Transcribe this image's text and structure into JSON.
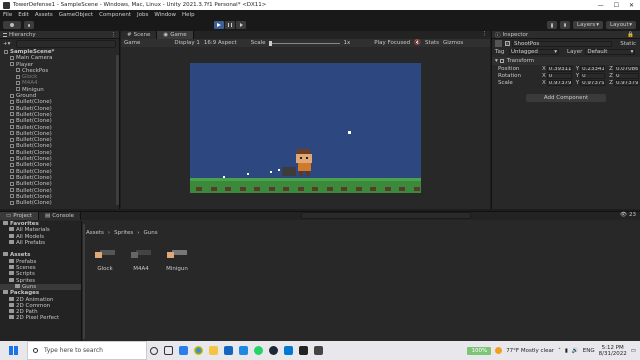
{
  "window": {
    "title": "TowerDefense1 - SampleScene - Windows, Mac, Linux - Unity 2021.3.7f1 Personal* <DX11>",
    "controls": [
      "—",
      "☐",
      "✕"
    ]
  },
  "menu": [
    "File",
    "Edit",
    "Assets",
    "GameObject",
    "Component",
    "Jobs",
    "Window",
    "Help"
  ],
  "toolbar": {
    "layers": "Layers",
    "layout": "Layout"
  },
  "hierarchy": {
    "tab": "Hierarchy",
    "rows": [
      {
        "label": "SampleScene*",
        "indent": 0,
        "bold": true
      },
      {
        "label": "Main Camera",
        "indent": 1
      },
      {
        "label": "Player",
        "indent": 1
      },
      {
        "label": "CheckPos",
        "indent": 2
      },
      {
        "label": "Glock",
        "indent": 2,
        "dim": true
      },
      {
        "label": "M4A4",
        "indent": 2,
        "dim": true
      },
      {
        "label": "Minigun",
        "indent": 2
      },
      {
        "label": "Ground",
        "indent": 1
      },
      {
        "label": "Bullet(Clone)",
        "indent": 1
      },
      {
        "label": "Bullet(Clone)",
        "indent": 1
      },
      {
        "label": "Bullet(Clone)",
        "indent": 1
      },
      {
        "label": "Bullet(Clone)",
        "indent": 1
      },
      {
        "label": "Bullet(Clone)",
        "indent": 1
      },
      {
        "label": "Bullet(Clone)",
        "indent": 1
      },
      {
        "label": "Bullet(Clone)",
        "indent": 1
      },
      {
        "label": "Bullet(Clone)",
        "indent": 1
      },
      {
        "label": "Bullet(Clone)",
        "indent": 1
      },
      {
        "label": "Bullet(Clone)",
        "indent": 1
      },
      {
        "label": "Bullet(Clone)",
        "indent": 1
      },
      {
        "label": "Bullet(Clone)",
        "indent": 1
      },
      {
        "label": "Bullet(Clone)",
        "indent": 1
      },
      {
        "label": "Bullet(Clone)",
        "indent": 1
      },
      {
        "label": "Bullet(Clone)",
        "indent": 1
      },
      {
        "label": "Bullet(Clone)",
        "indent": 1
      },
      {
        "label": "Bullet(Clone)",
        "indent": 1
      }
    ]
  },
  "game": {
    "tabs": [
      "Scene",
      "Game"
    ],
    "bar": {
      "mode": "Game",
      "display": "Display 1",
      "aspect": "16:9 Aspect",
      "scale_label": "Scale",
      "scale_value": "1x",
      "play_focused": "Play Focused",
      "stats": "Stats",
      "gizmos": "Gizmos"
    }
  },
  "inspector": {
    "tab": "Inspector",
    "object_name": "ShootPos",
    "static": "Static",
    "tag_label": "Tag",
    "tag_value": "Untagged",
    "layer_label": "Layer",
    "layer_value": "Default",
    "transform_label": "Transform",
    "rows": [
      {
        "label": "Position",
        "x": "0.39311",
        "y": "0.23341",
        "z": "0.07086"
      },
      {
        "label": "Rotation",
        "x": "0",
        "y": "0",
        "z": "0"
      },
      {
        "label": "Scale",
        "x": "0.97379",
        "y": "0.97379",
        "z": "0.97379"
      }
    ],
    "add_component": "Add Component"
  },
  "project": {
    "tabs": [
      "Project",
      "Console"
    ],
    "tree": [
      {
        "label": "Favorites",
        "indent": 0,
        "bold": true
      },
      {
        "label": "All Materials",
        "indent": 1
      },
      {
        "label": "All Models",
        "indent": 1
      },
      {
        "label": "All Prefabs",
        "indent": 1
      },
      {
        "label": "",
        "indent": 0
      },
      {
        "label": "Assets",
        "indent": 0,
        "bold": true
      },
      {
        "label": "Prefabs",
        "indent": 1
      },
      {
        "label": "Scenes",
        "indent": 1
      },
      {
        "label": "Scripts",
        "indent": 1
      },
      {
        "label": "Sprites",
        "indent": 1
      },
      {
        "label": "Guns",
        "indent": 2,
        "selected": true
      },
      {
        "label": "Packages",
        "indent": 0,
        "bold": true
      },
      {
        "label": "2D Animation",
        "indent": 1
      },
      {
        "label": "2D Common",
        "indent": 1
      },
      {
        "label": "2D Path",
        "indent": 1
      },
      {
        "label": "2D Pixel Perfect",
        "indent": 1
      }
    ],
    "breadcrumb": [
      "Assets",
      "Sprites",
      "Guns"
    ],
    "hidden_count": "23",
    "assets": [
      "Glock",
      "M4A4",
      "Minigun"
    ]
  },
  "taskbar": {
    "search_placeholder": "Type here to search",
    "battery": "100%",
    "weather": "77°F  Mostly clear",
    "lang": "ENG",
    "time": "5:12 PM",
    "date": "8/31/2022"
  },
  "colors": {
    "sky": "#2d4880",
    "grass": "#3b8a3c",
    "dirt": "#5a3a2a"
  }
}
